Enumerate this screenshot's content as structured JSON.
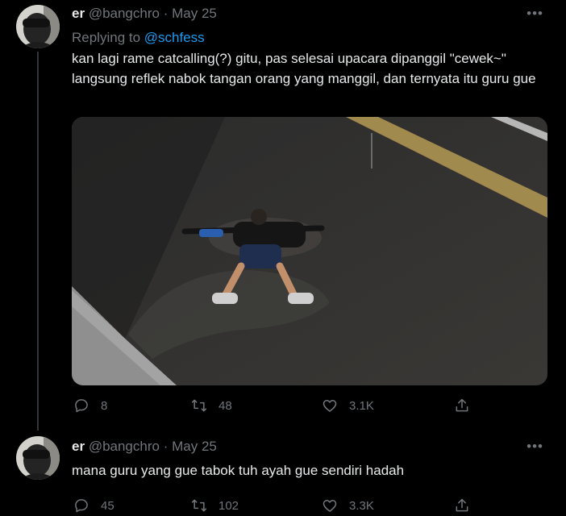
{
  "tweets": [
    {
      "name": "er",
      "handle": "@bangchro",
      "separator": "·",
      "date": "May 25",
      "more_icon": "more-horizontal-icon",
      "replying_to_label": "Replying to",
      "replying_to_handle": "@schfess",
      "text": "kan lagi rame catcalling(?) gitu, pas selesai upacara dipanggil \"cewek~\" langsung reflek nabok tangan orang yang manggil, dan ternyata itu guru gue",
      "actions": {
        "replies": "8",
        "retweets": "48",
        "likes": "3.1K"
      }
    },
    {
      "name": "er",
      "handle": "@bangchro",
      "separator": "·",
      "date": "May 25",
      "more_icon": "more-horizontal-icon",
      "text": "mana guru yang gue tabok tuh ayah gue sendiri hadah",
      "actions": {
        "replies": "45",
        "retweets": "102",
        "likes": "3.3K"
      }
    }
  ],
  "icons": {
    "reply": "reply-icon",
    "retweet": "retweet-icon",
    "like": "like-icon",
    "share": "share-icon"
  },
  "colors": {
    "background": "#000000",
    "text": "#e7e9ea",
    "muted": "#71767b",
    "link": "#1d9bf0",
    "thread_line": "#333639"
  }
}
